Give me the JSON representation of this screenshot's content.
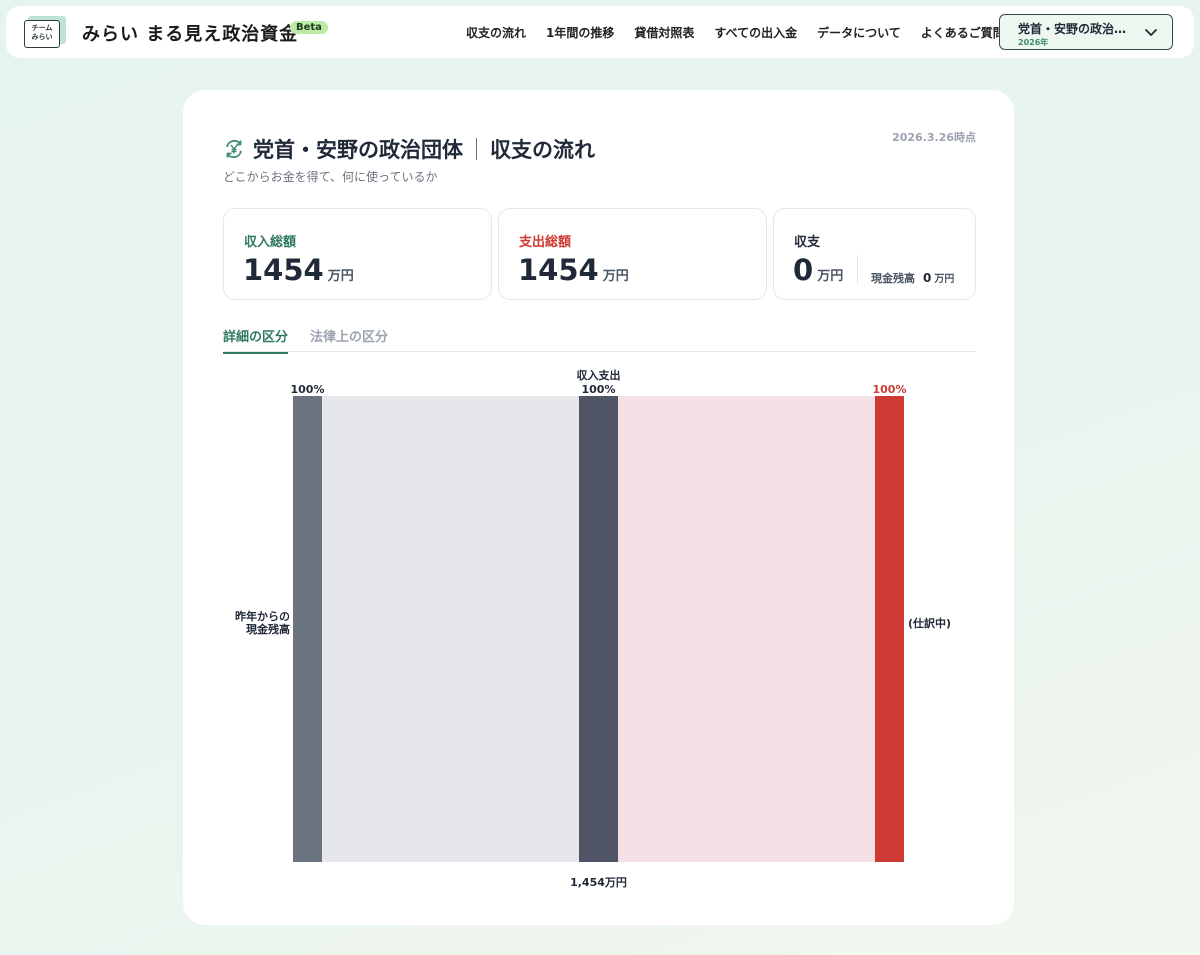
{
  "header": {
    "logo_line1": "チーム",
    "logo_line2": "みらい",
    "site_title": "みらい まる見え政治資金",
    "beta_badge": "Beta",
    "nav": [
      "収支の流れ",
      "1年間の推移",
      "貸借対照表",
      "すべての出入金",
      "データについて",
      "よくあるご質問"
    ],
    "org_select": {
      "name": "党首・安野の政治…",
      "year": "2026年",
      "icon": "chevron-down-icon"
    }
  },
  "page": {
    "title": "党首・安野の政治団体",
    "title_section": "収支の流れ",
    "subtitle": "どこからお金を得て、何に使っているか",
    "timestamp": "2026.3.26時点",
    "title_icon": "yen-cycle-icon"
  },
  "stats": {
    "income": {
      "label": "収入総額",
      "value": "1454",
      "unit": "万円",
      "color": "#2f7a5e"
    },
    "expense": {
      "label": "支出総額",
      "value": "1454",
      "unit": "万円",
      "color": "#cc3a33"
    },
    "balance": {
      "label": "収支",
      "value": "0",
      "unit": "万円",
      "cash_label": "現金残高",
      "cash_value": "0",
      "cash_unit": "万円"
    }
  },
  "tabs": [
    {
      "label": "詳細の区分",
      "active": true
    },
    {
      "label": "法律上の区分",
      "active": false
    }
  ],
  "chart_data": {
    "type": "sankey",
    "nodes": [
      {
        "id": "carryover",
        "label_lines": [
          "昨年からの",
          "現金残高"
        ],
        "percent_label": "100%",
        "color": "#6b7280"
      },
      {
        "id": "total",
        "label_lines": [
          "収入支出"
        ],
        "percent_label": "100%",
        "value_label": "1,454万円",
        "color": "#4f5567"
      },
      {
        "id": "pending",
        "label_lines": [
          "(仕訳中)"
        ],
        "percent_label": "100%",
        "color": "#cc3a33"
      }
    ],
    "links": [
      {
        "source": "carryover",
        "target": "total",
        "share": 1.0,
        "color": "#e5e7eb"
      },
      {
        "source": "total",
        "target": "pending",
        "share": 1.0,
        "color": "#f5e1e5"
      }
    ],
    "colors": {
      "income_label": "#1f2937",
      "expense_label": "#cc3a33"
    }
  }
}
